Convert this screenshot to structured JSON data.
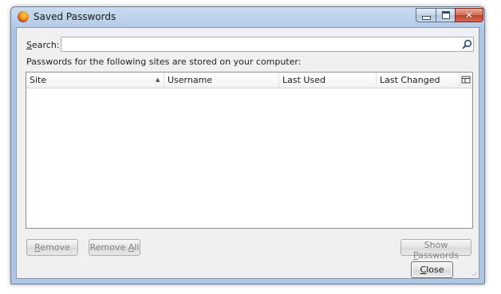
{
  "window": {
    "title": "Saved Passwords",
    "controls": {
      "minimize_icon": "minimize-icon",
      "maximize_icon": "maximize-icon",
      "close_glyph": "✕"
    }
  },
  "search": {
    "label": "Search:",
    "value": "",
    "placeholder": "",
    "icon": "magnifier-icon"
  },
  "info_text": "Passwords for the following sites are stored on your computer:",
  "table": {
    "columns": [
      {
        "label": "Site",
        "sorted": true,
        "sort_direction": "ascending"
      },
      {
        "label": "Username"
      },
      {
        "label": "Last Used"
      },
      {
        "label": "Last Changed"
      }
    ],
    "sort_glyph": "▲",
    "column_picker_icon": "column-picker-icon",
    "rows": []
  },
  "buttons": {
    "remove": "Remove",
    "remove_all": "Remove All",
    "show_passwords": "Show Passwords",
    "close": "Close"
  },
  "colors": {
    "titlebar": "#b7cde8",
    "client_bg": "#f0f0f0",
    "close_button": "#c0412b",
    "disabled_text": "#838383"
  }
}
